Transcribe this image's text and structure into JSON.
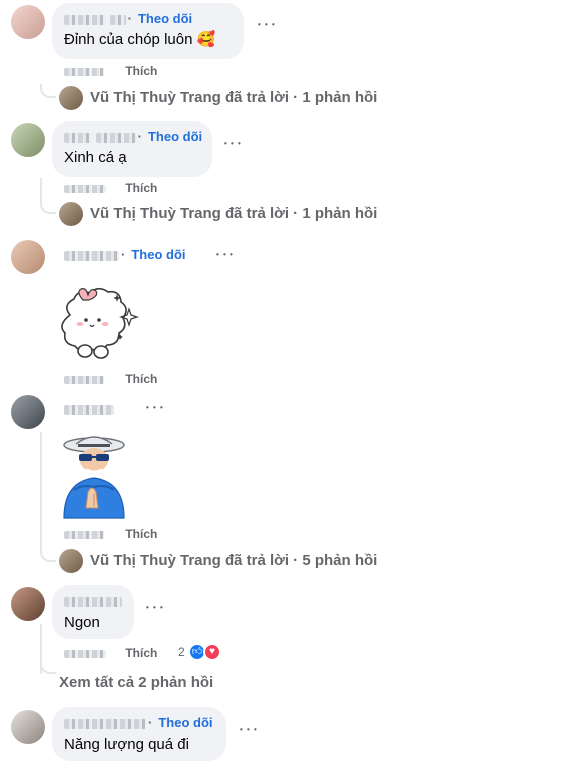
{
  "common": {
    "follow_label": "Theo dõi",
    "like_label": "Thích",
    "more_glyph": "• • •"
  },
  "comments": [
    {
      "text": "Đỉnh của chóp luôn 🥰",
      "reply_summary": "Vũ Thị Thuỳ Trang đã trả lời · 1 phản hồi"
    },
    {
      "text": "Xinh cá ạ",
      "reply_summary": "Vũ Thị Thuỳ Trang đã trả lời · 1 phản hồi"
    },
    {
      "text": ""
    },
    {
      "text": "",
      "reply_summary": "Vũ Thị Thuỳ Trang đã trả lời · 5 phản hồi"
    },
    {
      "text": "Ngon",
      "reaction_count": "2",
      "see_all": "Xem tất cả 2 phản hồi"
    },
    {
      "text": "Năng lượng quá đi"
    }
  ],
  "icons": {
    "like": "thumbs-up-icon",
    "love": "heart-icon",
    "sparkle": "✦"
  },
  "colors": {
    "follow": "#216fdb",
    "meta": "#65676b",
    "bubble": "#f0f2f5",
    "like_badge": "#1877f2",
    "love_badge": "#f33e58"
  }
}
